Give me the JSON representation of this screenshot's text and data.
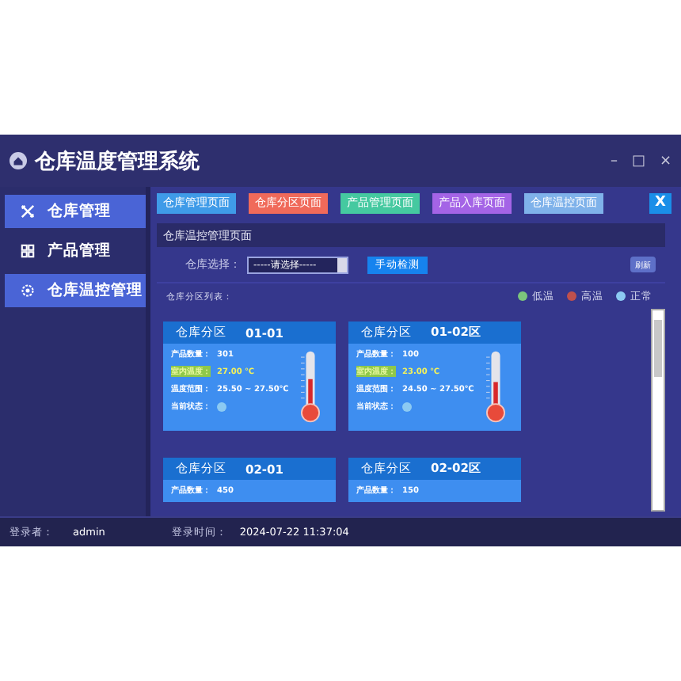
{
  "window": {
    "title": "仓库温度管理系统",
    "controls": [
      "–",
      "□",
      "×"
    ]
  },
  "sidebar": {
    "items": [
      {
        "label": "仓库管理",
        "highlighted": true
      },
      {
        "label": "产品管理",
        "highlighted": false
      },
      {
        "label": "仓库温控管理",
        "highlighted": true
      }
    ]
  },
  "tabs": [
    {
      "label": "仓库管理页面",
      "color": "#3f9be8"
    },
    {
      "label": "仓库分区页面",
      "color": "#f06a5a"
    },
    {
      "label": "产品管理页面",
      "color": "#45c9a0"
    },
    {
      "label": "产品入库页面",
      "color": "#a464e6"
    },
    {
      "label": "仓库温控页面",
      "color": "#7fb2ea"
    }
  ],
  "close_tab": "X",
  "panel": {
    "title": "仓库温控管理页面",
    "select_label": "仓库选择：",
    "select_value": "-----请选择-----",
    "check_button": "手动检测",
    "refresh_button": "刷新",
    "list_label": "仓库分区列表："
  },
  "legend": [
    {
      "label": "低温",
      "color": "#7cc47c"
    },
    {
      "label": "高温",
      "color": "#c0504d"
    },
    {
      "label": "正常",
      "color": "#8ccaf2"
    }
  ],
  "zones": [
    {
      "title": "仓库分区",
      "code": "01-01",
      "qty_label": "产品数量：",
      "qty": "301",
      "temp_label": "室内温度：",
      "temp": "27.00 ℃",
      "range_label": "温度范围：",
      "range": "25.50 ~ 27.50℃",
      "state_label": "当前状态：",
      "color": "#8ccaf2",
      "level": 0.58
    },
    {
      "title": "仓库分区",
      "code": "01-02区",
      "qty_label": "产品数量：",
      "qty": "100",
      "temp_label": "室内温度：",
      "temp": "23.00 ℃",
      "range_label": "温度范围：",
      "range": "24.50 ~ 27.50℃",
      "state_label": "当前状态：",
      "color": "#8ccaf2",
      "level": 0.52
    },
    {
      "title": "仓库分区",
      "code": "02-01",
      "qty_label": "产品数量：",
      "qty": "450"
    },
    {
      "title": "仓库分区",
      "code": "02-02区",
      "qty_label": "产品数量：",
      "qty": "150"
    }
  ],
  "status_bar": {
    "user_label": "登录者：",
    "user": "admin",
    "time_label": "登录时间：",
    "time": "2024-07-22 11:37:04"
  }
}
